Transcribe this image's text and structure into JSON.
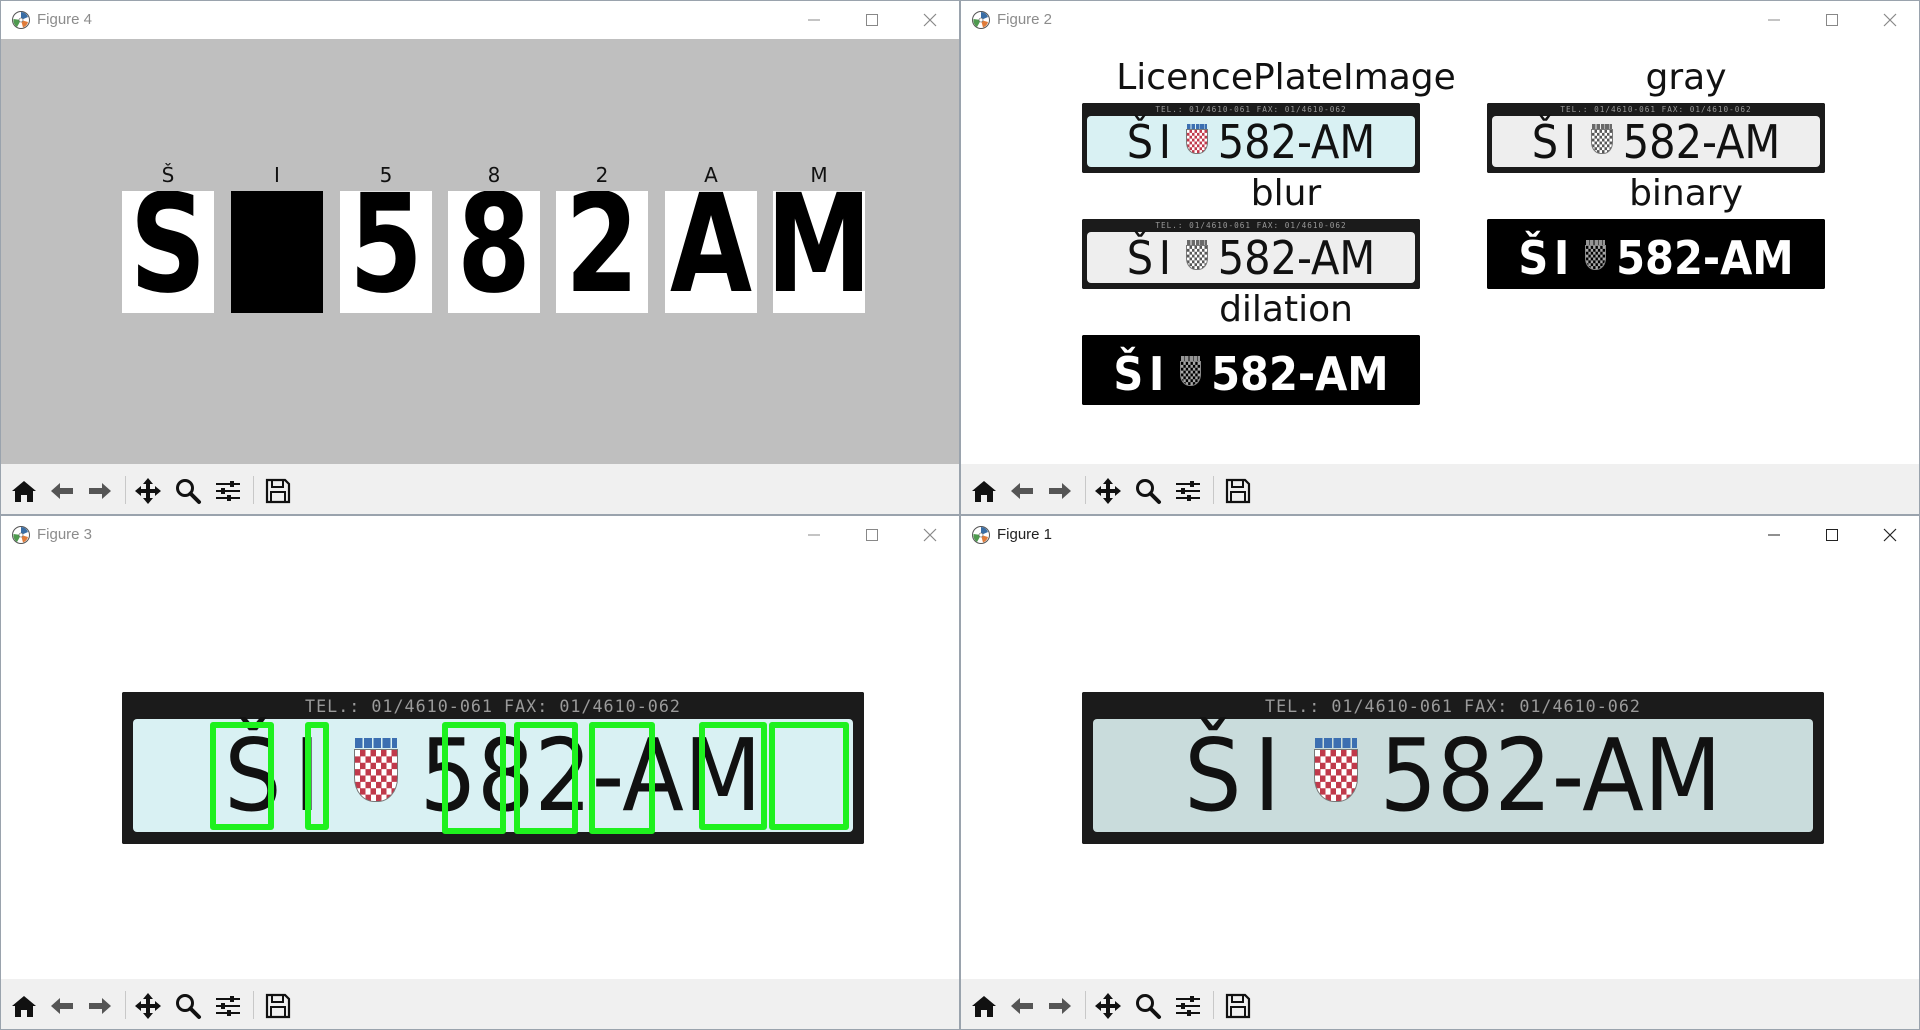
{
  "windows": {
    "fig4": {
      "title": "Figure 4"
    },
    "fig2": {
      "title": "Figure 2"
    },
    "fig3": {
      "title": "Figure 3"
    },
    "fig1": {
      "title": "Figure 1"
    }
  },
  "plate": {
    "header_text": "TEL.: 01/4610-061   FAX: 01/4610-062",
    "left_text": "ŠI",
    "right_text": "582-AM"
  },
  "figure4": {
    "characters": [
      "Š",
      "I",
      "5",
      "8",
      "2",
      "A",
      "M"
    ],
    "glyphs": [
      "S",
      "",
      "5",
      "8",
      "2",
      "A",
      "M"
    ],
    "background": "#bfbfbf"
  },
  "figure2": {
    "panels": [
      {
        "title": "LicencePlateImage",
        "style": "color"
      },
      {
        "title": "gray",
        "style": "gray"
      },
      {
        "title": "blur",
        "style": "gray"
      },
      {
        "title": "binary",
        "style": "binary"
      },
      {
        "title": "dilation",
        "style": "binary"
      }
    ]
  },
  "figure3": {
    "box_color": "#1ef11e"
  },
  "toolbar": {
    "icons": [
      "home-icon",
      "back-arrow-icon",
      "forward-arrow-icon",
      "pan-move-icon",
      "zoom-magnifier-icon",
      "configure-subplots-icon",
      "save-floppy-icon"
    ]
  },
  "colors": {
    "plate_color": "#d9f1f3",
    "plate_gray": "#eeeeee",
    "figure1_plate": "#c9dcdc",
    "toolbar_bg": "#f0f0f0"
  }
}
